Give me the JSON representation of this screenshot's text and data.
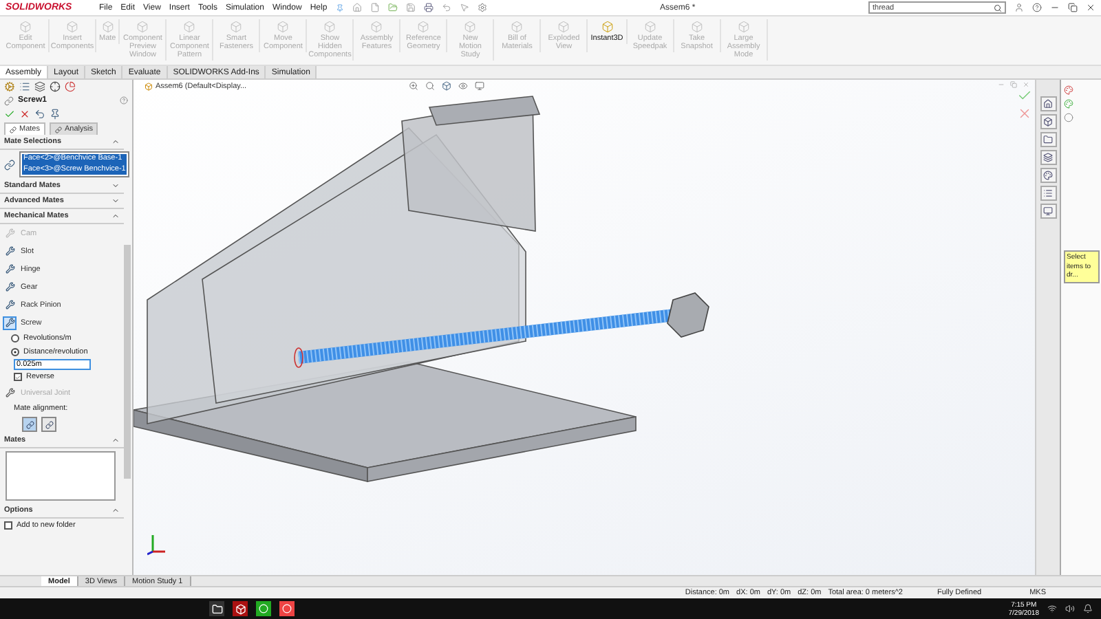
{
  "title_bar": {
    "logo": "SOLIDWORKS",
    "menus": [
      "File",
      "Edit",
      "View",
      "Insert",
      "Tools",
      "Simulation",
      "Window",
      "Help"
    ],
    "title": "Assem6 *",
    "search": {
      "value": "thread"
    }
  },
  "ribbon": [
    {
      "label": "Edit Component",
      "disabled": true
    },
    {
      "label": "Insert Components",
      "disabled": true
    },
    {
      "label": "Mate",
      "disabled": true
    },
    {
      "label": "Component Preview Window",
      "disabled": true
    },
    {
      "label": "Linear Component Pattern",
      "disabled": true
    },
    {
      "label": "Smart Fasteners",
      "disabled": true
    },
    {
      "label": "Move Component",
      "disabled": true
    },
    {
      "label": "Show Hidden Components",
      "disabled": true
    },
    {
      "label": "Assembly Features",
      "disabled": true
    },
    {
      "label": "Reference Geometry",
      "disabled": true
    },
    {
      "label": "New Motion Study",
      "disabled": true
    },
    {
      "label": "Bill of Materials",
      "disabled": true
    },
    {
      "label": "Exploded View",
      "disabled": true
    },
    {
      "label": "Instant3D",
      "disabled": false
    },
    {
      "label": "Update Speedpak",
      "disabled": true
    },
    {
      "label": "Take Snapshot",
      "disabled": true
    },
    {
      "label": "Large Assembly Mode",
      "disabled": true
    }
  ],
  "command_tabs": [
    {
      "label": "Assembly",
      "selected": true
    },
    {
      "label": "Layout",
      "selected": false
    },
    {
      "label": "Sketch",
      "selected": false
    },
    {
      "label": "Evaluate",
      "selected": false
    },
    {
      "label": "SOLIDWORKS Add-Ins",
      "selected": false
    },
    {
      "label": "Simulation",
      "selected": false
    }
  ],
  "property_manager": {
    "title": "Screw1",
    "tabs": [
      {
        "label": "Mates",
        "selected": true
      },
      {
        "label": "Analysis",
        "selected": false
      }
    ],
    "mate_selections": {
      "title": "Mate Selections",
      "expanded": true,
      "items": [
        "Face<2>@Benchvice Base-1",
        "Face<3>@Screw Benchvice-1"
      ]
    },
    "collapsed_sections": [
      {
        "title": "Standard Mates",
        "expanded": false
      },
      {
        "title": "Advanced Mates",
        "expanded": false
      }
    ],
    "mechanical_mates": {
      "title": "Mechanical Mates",
      "expanded": true,
      "mates": [
        {
          "label": "Cam",
          "selected": false,
          "disabled": true
        },
        {
          "label": "Slot",
          "selected": false,
          "disabled": false
        },
        {
          "label": "Hinge",
          "selected": false,
          "disabled": false
        },
        {
          "label": "Gear",
          "selected": false,
          "disabled": false
        },
        {
          "label": "Rack Pinion",
          "selected": false,
          "disabled": false
        },
        {
          "label": "Screw",
          "selected": true,
          "disabled": false
        }
      ],
      "screw_options": {
        "radios": [
          {
            "label": "Revolutions/m",
            "selected": false
          },
          {
            "label": "Distance/revolution",
            "selected": true
          }
        ],
        "value": "0.025m",
        "reverse": {
          "label": "Reverse",
          "checked": true
        }
      },
      "universal_joint": "Universal Joint",
      "alignment": {
        "label": "Mate alignment:",
        "options": [
          {
            "selected": true
          },
          {
            "selected": false
          }
        ]
      }
    },
    "mates_box": {
      "title": "Mates",
      "expanded": true
    },
    "options": {
      "title": "Options",
      "expanded": true,
      "checkbox": {
        "label": "Add to new folder",
        "checked": false
      }
    }
  },
  "viewport": {
    "tree_item": "Assem6  (Default<Display..."
  },
  "task_pane": {
    "tooltip": "Select items to dr..."
  },
  "bottom_tabs": [
    {
      "label": "Model",
      "selected": true
    },
    {
      "label": "3D Views",
      "selected": false
    },
    {
      "label": "Motion Study 1",
      "selected": false
    }
  ],
  "status_bar": {
    "measurements": [
      "Distance: 0m",
      "dX: 0m",
      "dY: 0m",
      "dZ: 0m",
      "Total area: 0 meters^2"
    ],
    "state": "Fully Defined",
    "units": "MKS"
  },
  "taskbar": {
    "time": "7:15 PM",
    "date": "7/29/2018"
  }
}
